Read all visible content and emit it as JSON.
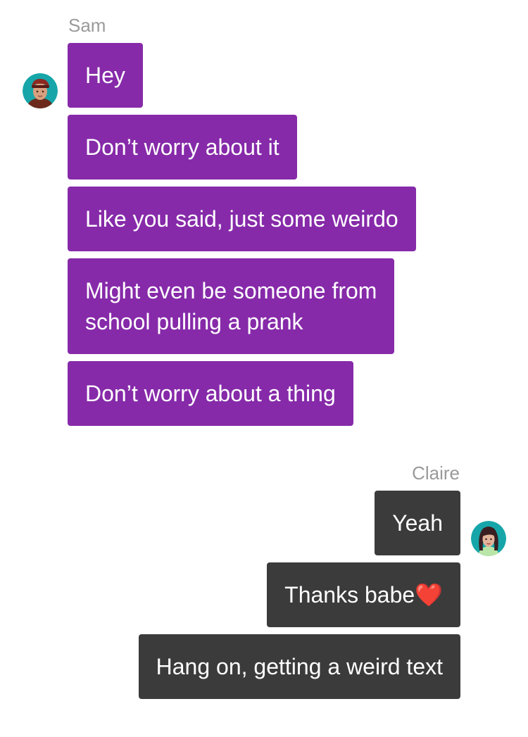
{
  "conversation": {
    "sam": {
      "name": "Sam",
      "avatar_icon": "male-avatar-icon",
      "bubble_color": "#862aa9",
      "messages": [
        "Hey",
        "Don’t worry about it",
        "Like you said, just some weirdo",
        "Might even be someone from\nschool pulling a prank",
        "Don’t worry about a thing"
      ]
    },
    "claire": {
      "name": "Claire",
      "avatar_icon": "female-avatar-icon",
      "bubble_color": "#3b3b3b",
      "messages": [
        "Yeah",
        "Thanks babe❤️",
        "Hang on, getting a weird text"
      ]
    }
  }
}
